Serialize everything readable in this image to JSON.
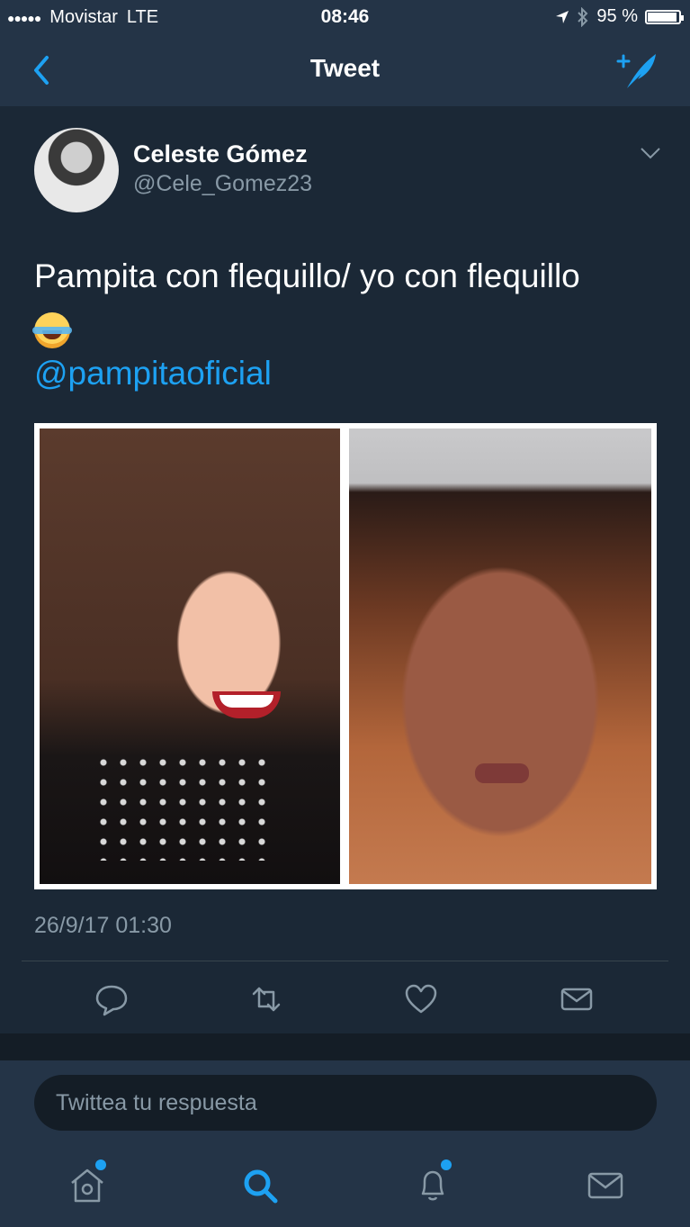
{
  "status_bar": {
    "carrier": "Movistar",
    "network": "LTE",
    "time": "08:46",
    "battery_percent_label": "95 %",
    "battery_level": 0.95
  },
  "nav": {
    "title": "Tweet"
  },
  "tweet": {
    "author_name": "Celeste Gómez",
    "author_handle": "@Cele_Gomez23",
    "text": "Pampita con flequillo/ yo con flequillo",
    "emoji": "face-with-tears-of-joy",
    "mention": "@pampitaoficial",
    "timestamp": "26/9/17 01:30",
    "actions": [
      "reply-icon",
      "retweet-icon",
      "like-icon",
      "direct-message-icon"
    ]
  },
  "reply": {
    "placeholder": "Twittea tu respuesta"
  },
  "tabbar": {
    "tabs": [
      "home-icon",
      "search-icon",
      "notifications-icon",
      "messages-icon"
    ],
    "active": "search-icon"
  },
  "colors": {
    "accent": "#1da1f2",
    "background": "#1b2836",
    "bar": "#243447",
    "muted": "#8899a6"
  }
}
